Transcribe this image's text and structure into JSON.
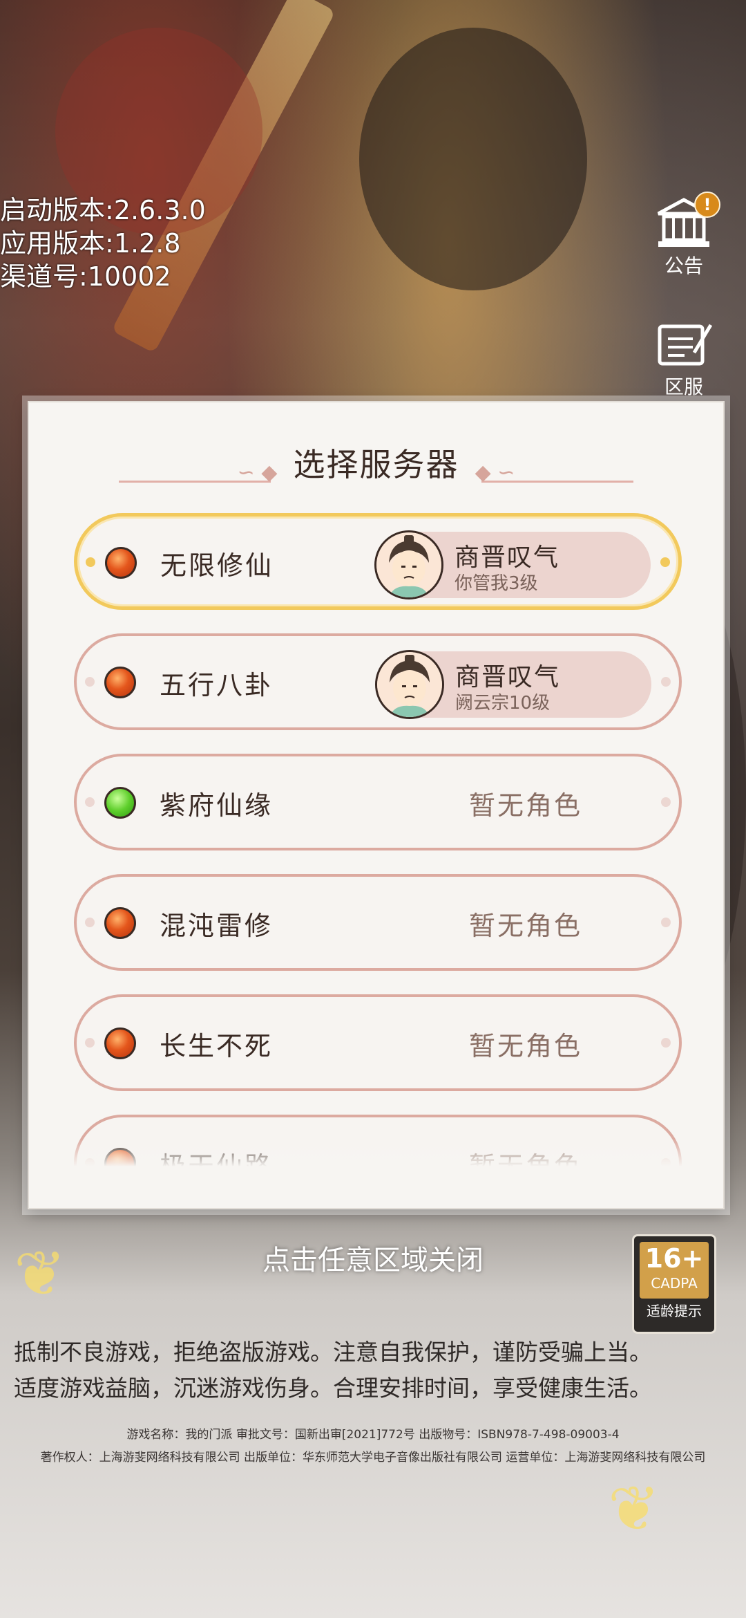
{
  "version_info": {
    "launch_version": "启动版本:2.6.3.0",
    "app_version": "应用版本:1.2.8",
    "channel": "渠道号:10002"
  },
  "side_buttons": {
    "notice_label": "公告",
    "notice_badge": "!",
    "server_label": "区服"
  },
  "dialog": {
    "title": "选择服务器",
    "servers": [
      {
        "name": "无限修仙",
        "status": "busy",
        "selected": true,
        "character": {
          "name": "商晋叹气",
          "level": "你管我3级"
        }
      },
      {
        "name": "五行八卦",
        "status": "busy",
        "selected": false,
        "character": {
          "name": "商晋叹气",
          "level": "阙云宗10级"
        }
      },
      {
        "name": "紫府仙缘",
        "status": "free",
        "selected": false,
        "no_role": "暂无角色"
      },
      {
        "name": "混沌雷修",
        "status": "busy",
        "selected": false,
        "no_role": "暂无角色"
      },
      {
        "name": "长生不死",
        "status": "busy",
        "selected": false,
        "no_role": "暂无角色"
      },
      {
        "name": "极天仙路",
        "status": "busy",
        "selected": false,
        "no_role": "暂无角色"
      }
    ]
  },
  "close_hint": "点击任意区域关闭",
  "rating": {
    "age": "16+",
    "org": "CADPA",
    "label": "适龄提示"
  },
  "health_notice": {
    "line1": "抵制不良游戏，拒绝盗版游戏。注意自我保护，谨防受骗上当。",
    "line2": "适度游戏益脑，沉迷游戏伤身。合理安排时间，享受健康生活。"
  },
  "legal": {
    "line1": "游戏名称：我的门派 审批文号：国新出审[2021]772号 出版物号：ISBN978-7-498-09003-4",
    "line2": "著作权人：上海游斐网络科技有限公司 出版单位：华东师范大学电子音像出版社有限公司 运营单位：上海游斐网络科技有限公司"
  },
  "colors": {
    "busy": "#e4561c",
    "free": "#5fcf2c",
    "selected_border": "#f2c95c",
    "item_border": "#dcaaa0"
  }
}
